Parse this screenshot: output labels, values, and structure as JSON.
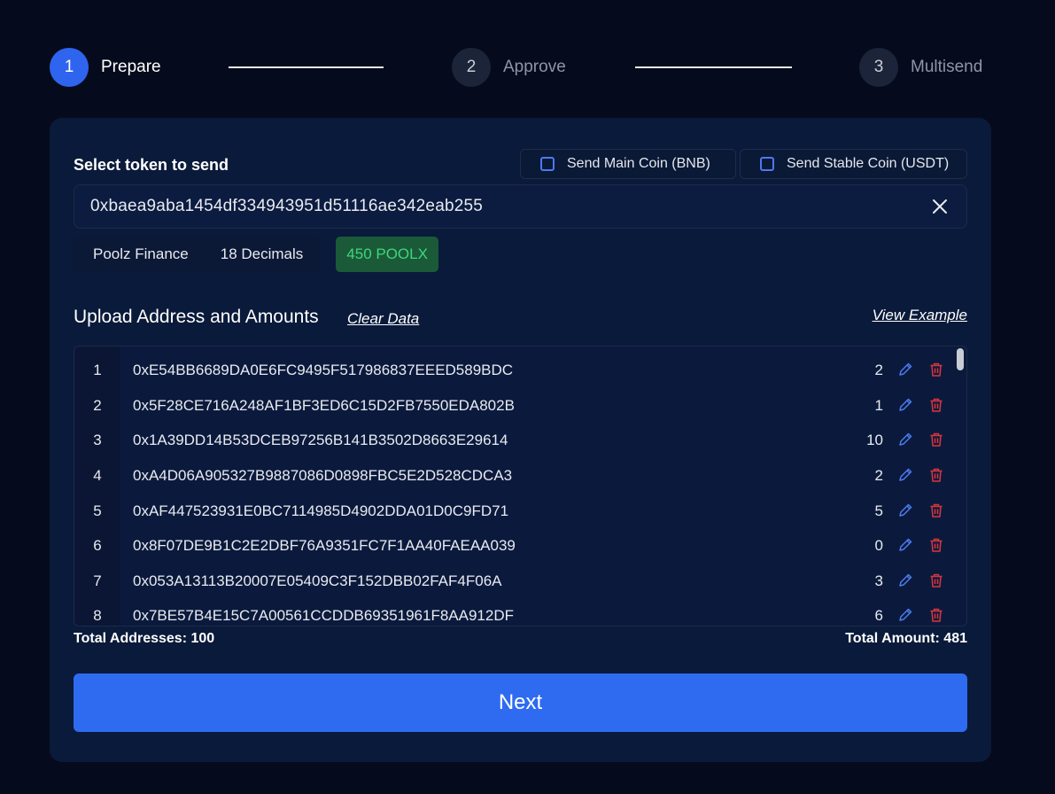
{
  "stepper": {
    "steps": [
      {
        "number": "1",
        "label": "Prepare",
        "active": true
      },
      {
        "number": "2",
        "label": "Approve",
        "active": false
      },
      {
        "number": "3",
        "label": "Multisend",
        "active": false
      }
    ]
  },
  "token": {
    "section_label": "Select token to send",
    "main_coin_label": "Send Main Coin (BNB)",
    "stable_coin_label": "Send Stable Coin (USDT)",
    "address": "0xbaea9aba1454df334943951d51116ae342eab255",
    "name": "Poolz Finance",
    "decimals": "18 Decimals",
    "balance": "450 POOLX"
  },
  "upload": {
    "title": "Upload Address and Amounts",
    "clear_label": "Clear Data",
    "example_label": "View Example"
  },
  "rows": [
    {
      "index": "1",
      "address": "0xE54BB6689DA0E6FC9495F517986837EEED589BDC",
      "amount": "2"
    },
    {
      "index": "2",
      "address": "0x5F28CE716A248AF1BF3ED6C15D2FB7550EDA802B",
      "amount": "1"
    },
    {
      "index": "3",
      "address": "0x1A39DD14B53DCEB97256B141B3502D8663E29614",
      "amount": "10"
    },
    {
      "index": "4",
      "address": "0xA4D06A905327B9887086D0898FBC5E2D528CDCA3",
      "amount": "2"
    },
    {
      "index": "5",
      "address": "0xAF447523931E0BC7114985D4902DDA01D0C9FD71",
      "amount": "5"
    },
    {
      "index": "6",
      "address": "0x8F07DE9B1C2E2DBF76A9351FC7F1AA40FAEAA039",
      "amount": "0"
    },
    {
      "index": "7",
      "address": "0x053A13113B20007E05409C3F152DBB02FAF4F06A",
      "amount": "3"
    },
    {
      "index": "8",
      "address": "0x7BE57B4E15C7A00561CCDDB69351961F8AA912DF",
      "amount": "6"
    }
  ],
  "totals": {
    "addresses": "Total Addresses: 100",
    "amount": "Total Amount: 481"
  },
  "next_label": "Next",
  "colors": {
    "accent": "#2e6bf0",
    "balance_text": "#3fd67c",
    "delete_icon": "#d9353e"
  }
}
